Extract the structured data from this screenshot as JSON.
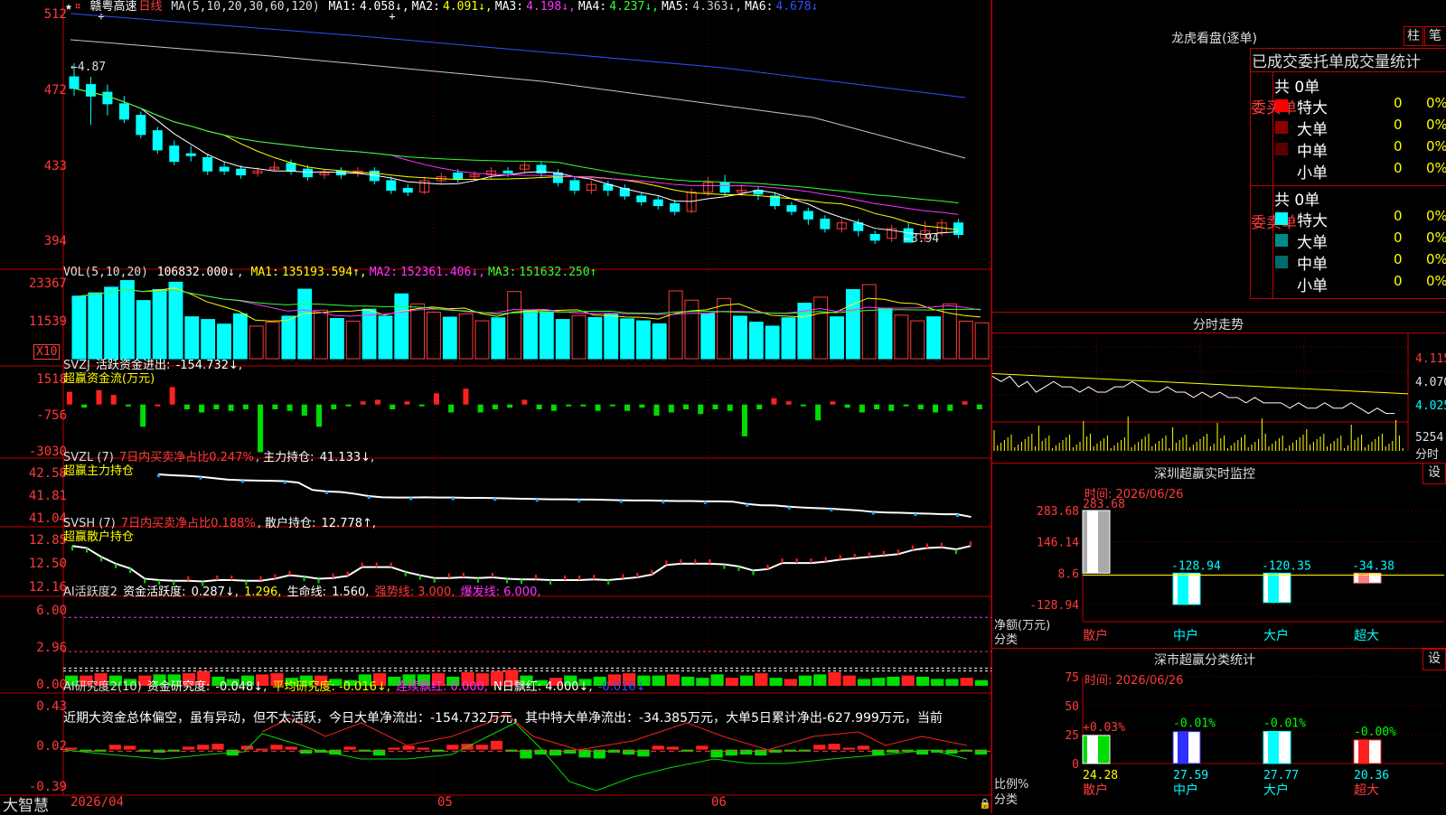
{
  "main": {
    "stock_name": "赣粤高速",
    "period": "日线",
    "ma_header": "MA(5,10,20,30,60,120)",
    "ma_values": [
      {
        "label": "MA1:",
        "value": "4.058↓",
        "color": "#ffffff"
      },
      {
        "label": "MA2:",
        "value": "4.091↓",
        "color": "#ffff00"
      },
      {
        "label": "MA3:",
        "value": "4.198↓",
        "color": "#ff33ff"
      },
      {
        "label": "MA4:",
        "value": "4.237↓",
        "color": "#33ff33"
      },
      {
        "label": "MA5:",
        "value": "4.363↓",
        "color": "#c8c8c8"
      },
      {
        "label": "MA6:",
        "value": "4.678↓",
        "color": "#3050ff"
      }
    ],
    "price_ticks": [
      "512",
      "472",
      "433",
      "394"
    ],
    "high_mark": "4.87",
    "low_mark": "3.94"
  },
  "vol": {
    "header": "VOL(5,10,20)",
    "value": "106832.000↓",
    "mas": [
      {
        "label": "MA1:",
        "value": "135193.594↑",
        "color": "#ffff00"
      },
      {
        "label": "MA2:",
        "value": "152361.406↓",
        "color": "#ff33ff"
      },
      {
        "label": "MA3:",
        "value": "151632.250↑",
        "color": "#33ff33"
      }
    ],
    "ticks": [
      "23367",
      "11539"
    ],
    "unit": "X10"
  },
  "svzj": {
    "header": "SVZJ",
    "label": "活跃资金进出:",
    "value": "-154.732↓,",
    "subtitle": "超赢资金流(万元)",
    "ticks": [
      "1518",
      "-756",
      "-3030"
    ]
  },
  "svzl": {
    "header": "SVZL (7)",
    "text1": "7日内买卖净占比0.247%",
    "label": "主力持仓:",
    "value": "41.133↓,",
    "subtitle": "超赢主力持仓",
    "ticks": [
      "42.58",
      "41.81",
      "41.04"
    ]
  },
  "svsh": {
    "header": "SVSH (7)",
    "text1": "7日内买卖净占比0.188%",
    "label": "散户持仓:",
    "value": "12.778↑,",
    "subtitle": "超赢散户持仓",
    "ticks": [
      "12.85",
      "12.50",
      "12.16"
    ]
  },
  "ai1": {
    "header": "AI活跃度2",
    "label": "资金活跃度:",
    "v1": "0.287↓,",
    "v2": "1.296,",
    "life_label": "生命线:",
    "life": "1.560,",
    "strong": "强势线: 3.000,",
    "burst": "爆发线: 6.000,",
    "ticks": [
      "6.00",
      "2.96",
      "0.00"
    ]
  },
  "ai2": {
    "header": "AI研究度2(10)",
    "label": "资金研究度:",
    "v1": "-0.048↓,",
    "avg": "平均研究度: -0.016↓,",
    "red": "连续飘红: 0.000,",
    "nred": "N日飘红: 4.000↓,",
    "last": "-0.016↓",
    "comment": "近期大资金总体偏空，虽有异动，但不太活跃，今日大单净流出：-154.732万元，其中特大单净流出：-34.385万元，大单5日累计净出-627.999万元，当前",
    "ticks": [
      "0.43",
      "0.02",
      "-0.39"
    ]
  },
  "xaxis": {
    "labels": [
      "2026/04",
      "05",
      "06"
    ],
    "brand": "大智慧"
  },
  "dragon": {
    "title": "龙虎看盘(逐单)",
    "tab1": "柱",
    "tab2": "笔",
    "table_title": "已成交委托单成交量统计",
    "buy_side": "委买单",
    "sell_side": "委卖单",
    "buy_total": "共 0单",
    "sell_total": "共 0单",
    "buy_rows": [
      {
        "name": "特大",
        "count": "0",
        "pct": "0%",
        "color": "#ff0000"
      },
      {
        "name": "大单",
        "count": "0",
        "pct": "0%",
        "color": "#8b0000"
      },
      {
        "name": "中单",
        "count": "0",
        "pct": "0%",
        "color": "#5a0000"
      },
      {
        "name": "小单",
        "count": "0",
        "pct": "0%",
        "color": "#000000"
      }
    ],
    "sell_rows": [
      {
        "name": "特大",
        "count": "0",
        "pct": "0%",
        "color": "#00ffff"
      },
      {
        "name": "大单",
        "count": "0",
        "pct": "0%",
        "color": "#008b8b"
      },
      {
        "name": "中单",
        "count": "0",
        "pct": "0%",
        "color": "#006b6b"
      },
      {
        "name": "小单",
        "count": "0",
        "pct": "0%",
        "color": "#000000"
      }
    ]
  },
  "intraday": {
    "title": "分时走势",
    "ticks": [
      "4.115",
      "4.070",
      "4.025"
    ],
    "vol_tick": "5254",
    "unit": "分时"
  },
  "monitor": {
    "title": "深圳超赢实时监控",
    "settings": "设",
    "time": "时间: 2026/06/26",
    "ylabel": "净额(万元)",
    "xlabel": "分类"
  },
  "stats": {
    "title": "深市超赢分类统计",
    "settings": "设",
    "time": "时间: 2026/06/26",
    "ylabel": "比例%",
    "xlabel": "分类"
  },
  "chart_data": [
    {
      "type": "candlestick",
      "title": "赣粤高速 日线",
      "ylim": [
        3.85,
        5.15
      ],
      "yticks": [
        5.12,
        4.72,
        4.33,
        3.94
      ],
      "candles": [
        [
          4.8,
          4.74,
          4.87,
          4.7
        ],
        [
          4.76,
          4.7,
          4.8,
          4.55
        ],
        [
          4.72,
          4.66,
          4.76,
          4.6
        ],
        [
          4.66,
          4.58,
          4.7,
          4.56
        ],
        [
          4.6,
          4.5,
          4.62,
          4.48
        ],
        [
          4.52,
          4.42,
          4.54,
          4.4
        ],
        [
          4.44,
          4.36,
          4.47,
          4.34
        ],
        [
          4.4,
          4.39,
          4.44,
          4.36
        ],
        [
          4.38,
          4.31,
          4.4,
          4.29
        ],
        [
          4.33,
          4.31,
          4.36,
          4.29
        ],
        [
          4.32,
          4.29,
          4.34,
          4.27
        ],
        [
          4.3,
          4.31,
          4.33,
          4.28
        ],
        [
          4.32,
          4.33,
          4.36,
          4.31
        ],
        [
          4.35,
          4.31,
          4.37,
          4.29
        ],
        [
          4.32,
          4.28,
          4.34,
          4.26
        ],
        [
          4.29,
          4.3,
          4.32,
          4.27
        ],
        [
          4.31,
          4.29,
          4.33,
          4.27
        ],
        [
          4.3,
          4.31,
          4.33,
          4.28
        ],
        [
          4.31,
          4.26,
          4.33,
          4.24
        ],
        [
          4.26,
          4.21,
          4.28,
          4.19
        ],
        [
          4.22,
          4.2,
          4.24,
          4.18
        ],
        [
          4.2,
          4.26,
          4.28,
          4.19
        ],
        [
          4.26,
          4.28,
          4.3,
          4.24
        ],
        [
          4.3,
          4.27,
          4.32,
          4.25
        ],
        [
          4.28,
          4.29,
          4.31,
          4.26
        ],
        [
          4.29,
          4.31,
          4.33,
          4.27
        ],
        [
          4.31,
          4.3,
          4.33,
          4.28
        ],
        [
          4.32,
          4.34,
          4.36,
          4.3
        ],
        [
          4.34,
          4.3,
          4.36,
          4.28
        ],
        [
          4.3,
          4.25,
          4.32,
          4.23
        ],
        [
          4.26,
          4.21,
          4.28,
          4.19
        ],
        [
          4.21,
          4.24,
          4.26,
          4.19
        ],
        [
          4.24,
          4.21,
          4.26,
          4.18
        ],
        [
          4.22,
          4.18,
          4.24,
          4.16
        ],
        [
          4.18,
          4.15,
          4.2,
          4.13
        ],
        [
          4.16,
          4.13,
          4.18,
          4.11
        ],
        [
          4.14,
          4.1,
          4.16,
          4.08
        ],
        [
          4.1,
          4.2,
          4.22,
          4.09
        ],
        [
          4.2,
          4.25,
          4.28,
          4.18
        ],
        [
          4.25,
          4.2,
          4.29,
          4.18
        ],
        [
          4.2,
          4.21,
          4.24,
          4.18
        ],
        [
          4.21,
          4.19,
          4.23,
          4.16
        ],
        [
          4.18,
          4.13,
          4.2,
          4.11
        ],
        [
          4.13,
          4.1,
          4.15,
          4.08
        ],
        [
          4.1,
          4.06,
          4.12,
          4.03
        ],
        [
          4.06,
          4.01,
          4.08,
          3.99
        ],
        [
          4.01,
          4.04,
          4.06,
          3.99
        ],
        [
          4.04,
          4.0,
          4.06,
          3.97
        ],
        [
          3.98,
          3.95,
          4.0,
          3.93
        ],
        [
          3.96,
          4.01,
          4.03,
          3.94
        ],
        [
          4.01,
          3.94,
          4.04,
          3.94
        ],
        [
          3.96,
          4.0,
          4.05,
          3.94
        ],
        [
          3.99,
          4.04,
          4.06,
          3.97
        ],
        [
          4.04,
          3.98,
          4.06,
          3.96
        ]
      ]
    },
    {
      "type": "bar",
      "title": "VOL(5,10,20)",
      "ylim": [
        0,
        25000
      ],
      "values": [
        18800,
        19800,
        21500,
        23500,
        17500,
        20800,
        23000,
        12600,
        11800,
        10400,
        13500,
        9800,
        11000,
        12800,
        20900,
        14600,
        12100,
        11300,
        14900,
        12800,
        19500,
        16500,
        14000,
        12500,
        13500,
        11400,
        12300,
        20200,
        14500,
        14100,
        11800,
        13000,
        12400,
        13400,
        12000,
        11400,
        10500,
        20400,
        17600,
        13600,
        18100,
        12800,
        11000,
        9800,
        12300,
        16700,
        18500,
        12600,
        20800,
        22300,
        15200,
        13100,
        11400,
        12600,
        16500,
        11300,
        10800
      ]
    },
    {
      "type": "bar",
      "title": "超赢资金流(万元)",
      "ylim": [
        -3030,
        1518
      ],
      "values": [
        800,
        -200,
        900,
        600,
        -100,
        -1400,
        0,
        1100,
        -300,
        -500,
        -300,
        -400,
        -300,
        -3000,
        -300,
        -400,
        -700,
        -1400,
        -300,
        -100,
        200,
        300,
        -300,
        200,
        -100,
        700,
        -500,
        1000,
        -500,
        -300,
        -200,
        300,
        -300,
        -400,
        -100,
        -100,
        -400,
        -100,
        -400,
        -200,
        -700,
        -500,
        -300,
        -600,
        -300,
        -400,
        -2000,
        -300,
        400,
        200,
        -100,
        -1000,
        200,
        -200,
        -500,
        -300,
        -400,
        -100,
        -300,
        -500,
        -400,
        200,
        -300
      ]
    },
    {
      "type": "line",
      "title": "超赢主力持仓",
      "ylim": [
        41.04,
        42.58
      ],
      "values": [
        42.58,
        42.55,
        42.53,
        42.5,
        42.45,
        42.4,
        42.38,
        42.37,
        42.36,
        42.35,
        42.3,
        42.05,
        42.0,
        41.98,
        41.92,
        41.84,
        41.8,
        41.79,
        41.79,
        41.8,
        41.79,
        41.79,
        41.78,
        41.78,
        41.77,
        41.76,
        41.75,
        41.74,
        41.73,
        41.73,
        41.72,
        41.72,
        41.71,
        41.7,
        41.69,
        41.69,
        41.68,
        41.67,
        41.67,
        41.66,
        41.66,
        41.65,
        41.57,
        41.53,
        41.52,
        41.48,
        41.45,
        41.43,
        41.41,
        41.38,
        41.35,
        41.3,
        41.28,
        41.27,
        41.25,
        41.24,
        41.22,
        41.22,
        41.13
      ]
    },
    {
      "type": "line",
      "title": "超赢散户持仓",
      "ylim": [
        12.16,
        12.85
      ],
      "values": [
        12.78,
        12.75,
        12.62,
        12.52,
        12.45,
        12.3,
        12.28,
        12.27,
        12.27,
        12.26,
        12.28,
        12.28,
        12.27,
        12.27,
        12.3,
        12.35,
        12.33,
        12.3,
        12.31,
        12.34,
        12.47,
        12.47,
        12.47,
        12.4,
        12.35,
        12.31,
        12.31,
        12.32,
        12.31,
        12.32,
        12.3,
        12.29,
        12.29,
        12.28,
        12.28,
        12.28,
        12.29,
        12.28,
        12.3,
        12.32,
        12.36,
        12.5,
        12.52,
        12.52,
        12.52,
        12.51,
        12.48,
        12.42,
        12.44,
        12.53,
        12.53,
        12.53,
        12.55,
        12.58,
        12.6,
        12.62,
        12.64,
        12.66,
        12.72,
        12.75,
        12.76,
        12.73,
        12.78
      ]
    },
    {
      "type": "bar",
      "title": "AI活跃度2",
      "ylim": [
        0,
        6.5
      ],
      "values": [
        0.9,
        0.9,
        1.1,
        0.9,
        0.6,
        0.9,
        1.0,
        1.0,
        1.1,
        1.3,
        0.8,
        0.6,
        0.9,
        1.0,
        1.1,
        0.7,
        0.9,
        0.9,
        0.6,
        0.5,
        1.0,
        1.1,
        0.8,
        1.0,
        1.0,
        1.1,
        0.8,
        1.2,
        1.1,
        1.3,
        1.4,
        0.9,
        0.5,
        0.7,
        0.9,
        0.6,
        0.8,
        1.0,
        1.1,
        0.9,
        0.9,
        1.0,
        0.8,
        0.7,
        1.0,
        0.7,
        0.9,
        1.1,
        0.7,
        0.6,
        0.9,
        1.0,
        1.2,
        0.9,
        0.6,
        0.7,
        0.8,
        0.9,
        0.8,
        0.6,
        0.6,
        0.7,
        0.5
      ],
      "lines": {
        "strong": 3.0,
        "burst": 6.0
      }
    },
    {
      "type": "bar",
      "title": "AI研究度2(10)",
      "ylim": [
        -0.39,
        0.43
      ],
      "values": [
        0.02,
        -0.01,
        -0.02,
        0.05,
        0.04,
        -0.02,
        -0.03,
        -0.02,
        0.03,
        0.05,
        0.06,
        -0.06,
        0.04,
        0.01,
        0.05,
        0.03,
        -0.04,
        -0.03,
        -0.05,
        0.03,
        -0.02,
        -0.06,
        0.02,
        0.04,
        0.02,
        -0.02,
        0.05,
        0.06,
        0.05,
        0.09,
        -0.02,
        -0.09,
        -0.05,
        -0.06,
        -0.04,
        -0.08,
        -0.09,
        -0.03,
        -0.05,
        -0.07,
        0.04,
        0.03,
        -0.02,
        0.04,
        -0.08,
        -0.06,
        -0.05,
        -0.06,
        -0.03,
        -0.02,
        -0.01,
        0.05,
        0.06,
        0.02,
        0.04,
        -0.06,
        -0.03,
        -0.02,
        -0.05,
        -0.03,
        -0.04,
        -0.02,
        -0.05
      ]
    },
    {
      "type": "line",
      "title": "分时走势",
      "ylim": [
        4.0,
        4.13
      ],
      "values": [
        4.06,
        4.05,
        4.06,
        4.04,
        4.05,
        4.03,
        4.04,
        4.05,
        4.04,
        4.04,
        4.03,
        4.04,
        4.03,
        4.03,
        4.04,
        4.04,
        4.05,
        4.04,
        4.03,
        4.03,
        4.04,
        4.03,
        4.03,
        4.02,
        4.03,
        4.02,
        4.03,
        4.02,
        4.02,
        4.01,
        4.02,
        4.01,
        4.01,
        4.01,
        4.0,
        4.01,
        4.0,
        4.0,
        4.01,
        4.0,
        4.0,
        4.01,
        4.0,
        3.99,
        4.0,
        3.99,
        3.99
      ]
    },
    {
      "type": "bar",
      "title": "深圳超赢实时监控",
      "categories": [
        "散户",
        "中户",
        "大户",
        "超大"
      ],
      "values": [
        283.68,
        -128.94,
        -120.35,
        -34.38
      ],
      "ylim": [
        -128.94,
        283.68
      ],
      "yticks": [
        283.68,
        146.14,
        8.6,
        -128.94
      ]
    },
    {
      "type": "bar",
      "title": "深市超赢分类统计",
      "categories": [
        "散户",
        "中户",
        "大户",
        "超大"
      ],
      "values": [
        24.28,
        27.59,
        27.77,
        20.36
      ],
      "changes": [
        "+0.03%",
        "-0.01%",
        "-0.01%",
        "-0.00%"
      ],
      "ylim": [
        0,
        75
      ],
      "yticks": [
        75,
        50,
        25,
        0
      ]
    }
  ]
}
